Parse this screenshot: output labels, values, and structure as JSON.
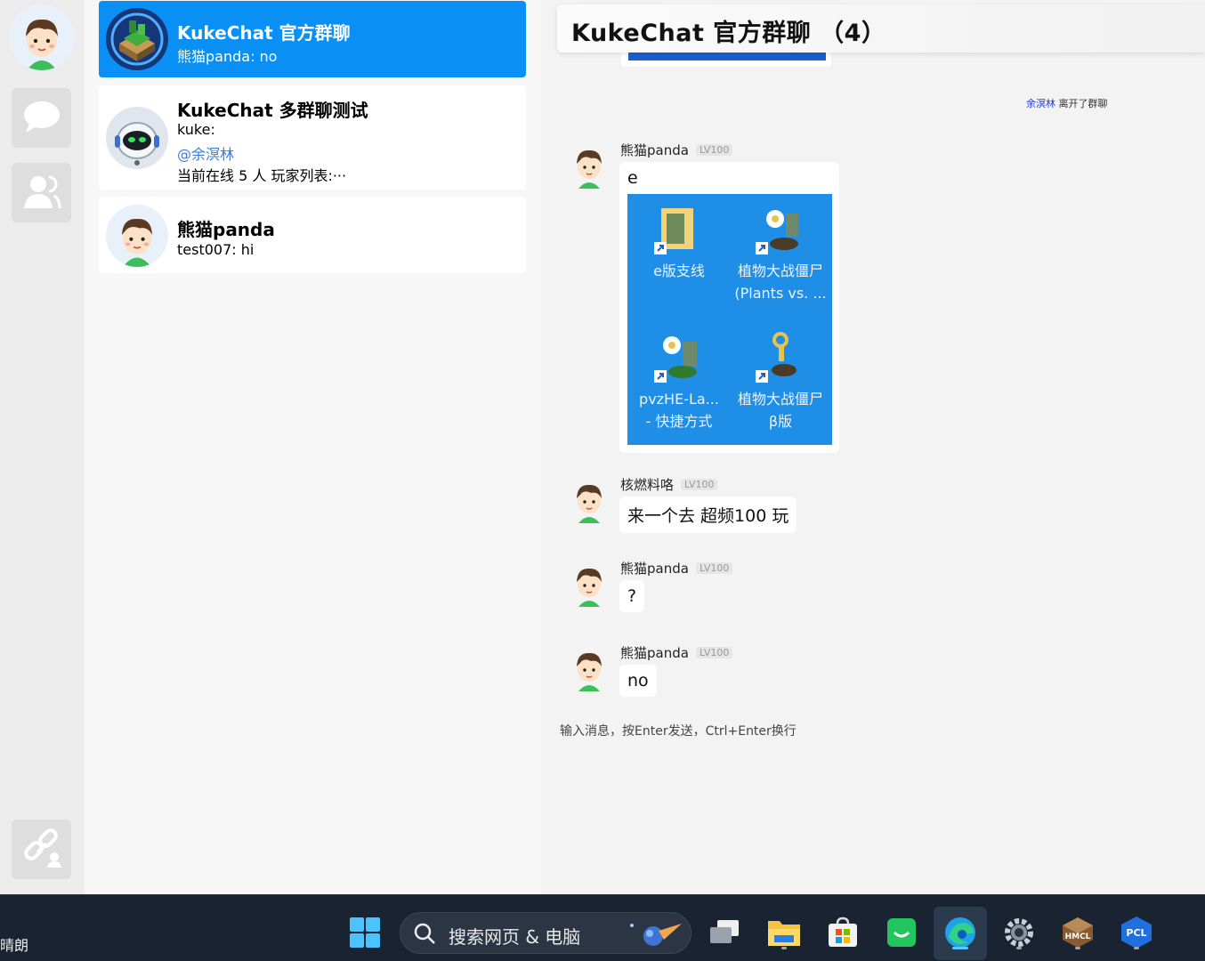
{
  "conversations": [
    {
      "name": "KukeChat 官方群聊",
      "line1": "熊猫panda: no"
    },
    {
      "name": "KukeChat 多群聊测试",
      "line1": "kuke:",
      "line2": "@余溟林",
      "line3": "当前在线 5 人 玩家列表:···"
    },
    {
      "name": "熊猫panda",
      "line1": "test007: hi"
    }
  ],
  "chat": {
    "title": "KukeChat 官方群聊 （4）",
    "system_notice": {
      "who": "余溟林",
      "text": " 离开了群聊"
    },
    "messages": [
      {
        "sender": "熊猫panda",
        "level": "LV100",
        "text": "e",
        "image_icons": [
          {
            "label1": "e版支线",
            "label2": ""
          },
          {
            "label1": "植物大战僵尸",
            "label2": "(Plants vs. ..."
          },
          {
            "label1": "pvzHE-La...",
            "label2": "- 快捷方式"
          },
          {
            "label1": "植物大战僵尸",
            "label2": "β版"
          }
        ]
      },
      {
        "sender": "核燃料咯",
        "level": "LV100",
        "text": "来一个去 超频100 玩"
      },
      {
        "sender": "熊猫panda",
        "level": "LV100",
        "text": "?"
      },
      {
        "sender": "熊猫panda",
        "level": "LV100",
        "text": "no"
      }
    ],
    "input_placeholder": "输入消息，按Enter发送，Ctrl+Enter换行"
  },
  "taskbar": {
    "weather": "晴朗",
    "search_placeholder": "搜索网页 & 电脑",
    "pcl_label": "PCL",
    "hmcl_label": "HMCL"
  },
  "colors": {
    "accent": "#0a90f5",
    "taskbar": "#1a2331",
    "mention": "#3b7bd8"
  }
}
